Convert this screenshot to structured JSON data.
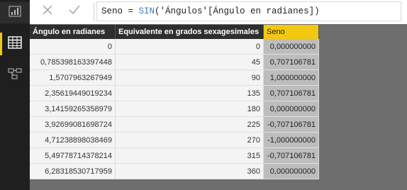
{
  "formula_bar": {
    "cancel_icon": "close-icon",
    "commit_icon": "check-icon",
    "formula_prefix": "Seno = ",
    "formula_function": "SIN",
    "formula_args": "('Ángulos'[Ángulo en radianes])"
  },
  "nav": [
    {
      "name": "report-view",
      "icon": "bar-chart-icon"
    },
    {
      "name": "data-view",
      "icon": "table-icon",
      "active": true
    },
    {
      "name": "model-view",
      "icon": "relationships-icon"
    }
  ],
  "table": {
    "columns": [
      "Ángulo en radianes",
      "Equivalente en grados sexagesimales",
      "Seno"
    ],
    "selected_column": "Seno",
    "rows": [
      [
        "0",
        "0",
        "0,000000000"
      ],
      [
        "0,785398163397448",
        "45",
        "0,707106781"
      ],
      [
        "1,5707963267949",
        "90",
        "1,000000000"
      ],
      [
        "2,35619449019234",
        "135",
        "0,707106781"
      ],
      [
        "3,14159265358979",
        "180",
        "0,000000000"
      ],
      [
        "3,92699081698724",
        "225",
        "-0,707106781"
      ],
      [
        "4,71238898038469",
        "270",
        "-1,000000000"
      ],
      [
        "5,49778714378214",
        "315",
        "-0,707106781"
      ],
      [
        "6,28318530717959",
        "360",
        "0,000000000"
      ]
    ]
  },
  "colors": {
    "accent": "#f2c811",
    "rail": "#1f1f1f",
    "workspace": "#6e6e6e",
    "header": "#2e2e2e",
    "function": "#3d7eb8"
  }
}
